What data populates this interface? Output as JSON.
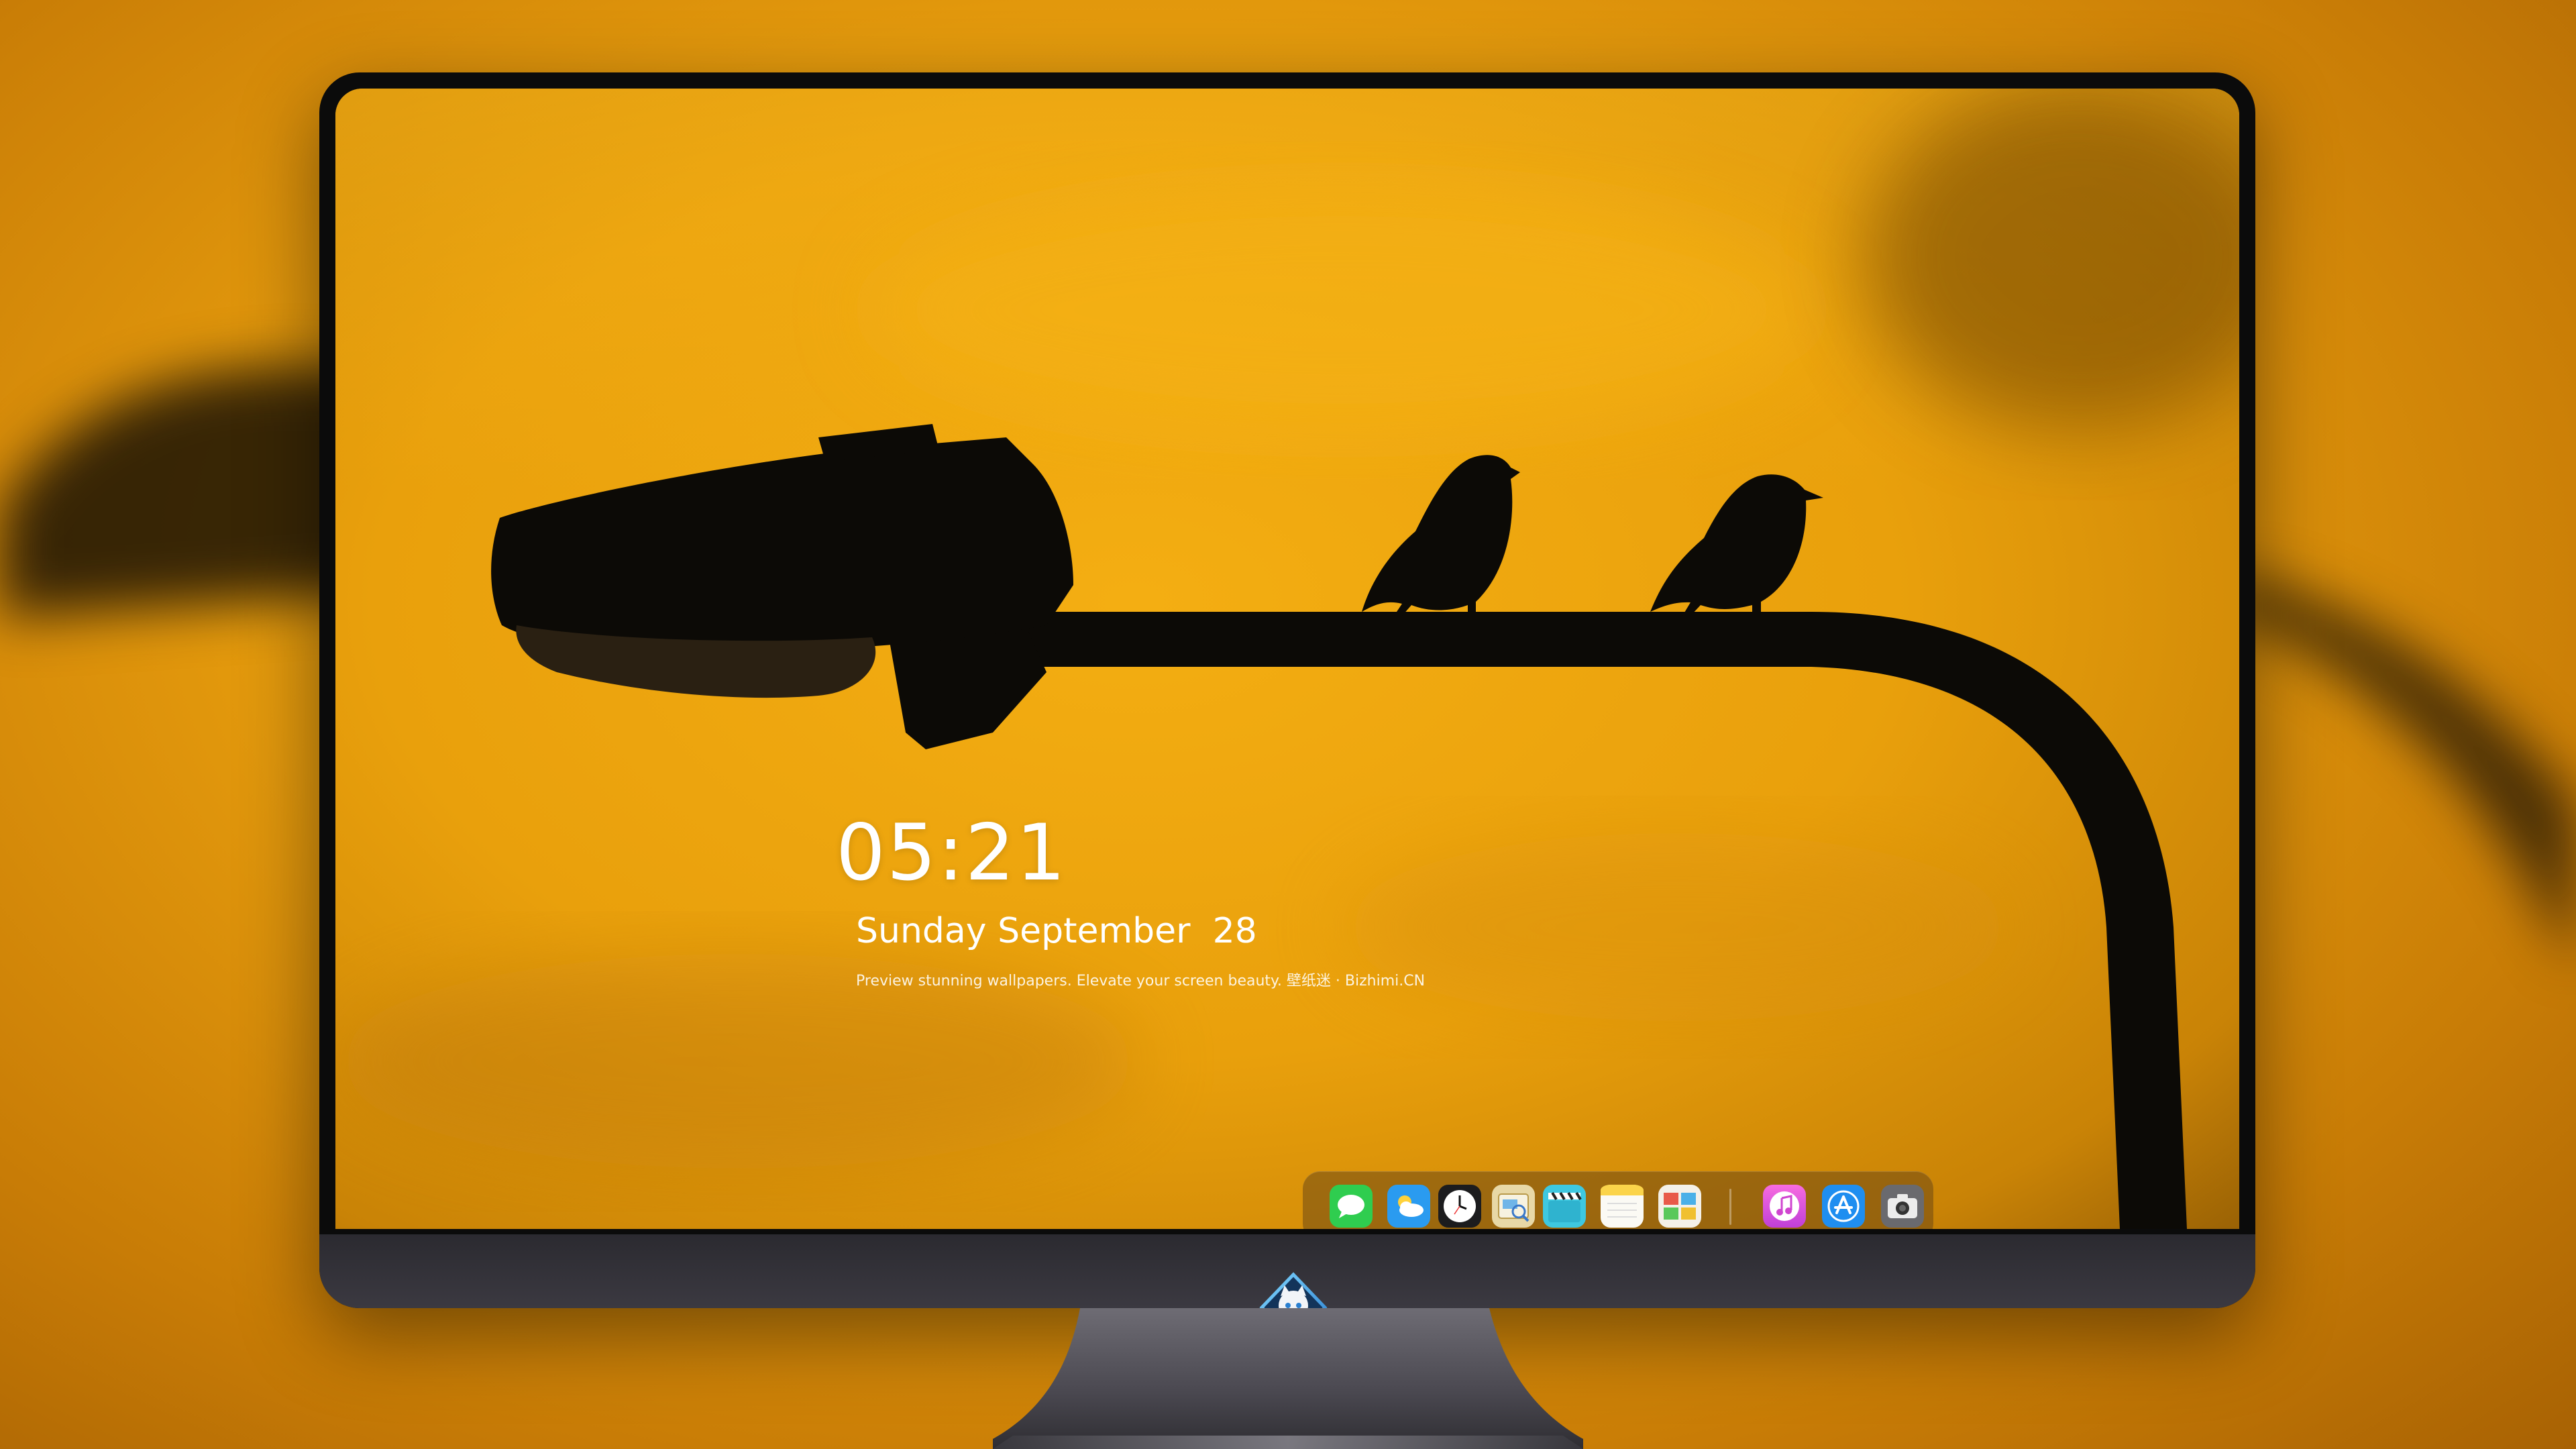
{
  "lockscreen": {
    "time": "05:21",
    "date": "Sunday September  28",
    "caption": "Preview stunning wallpapers. Elevate your screen beauty. 壁纸迷 · Bizhimi.CN"
  },
  "dock": {
    "apps": [
      {
        "icon": "messages-icon",
        "color": "#2fcd4f"
      },
      {
        "icon": "weather-icon",
        "color": "#2a9bf0"
      },
      {
        "icon": "clock-icon",
        "color": "#1c1c1e"
      },
      {
        "icon": "preview-icon",
        "color": "#e8d8a6"
      },
      {
        "icon": "clapperboard-icon",
        "color": "#3ec8e0"
      },
      {
        "icon": "notes-icon",
        "color": "#fbe28a"
      },
      {
        "icon": "photo-booth-icon",
        "color": "#f4f0e8"
      },
      {
        "icon": "music-icon",
        "color": "#e34fd0"
      },
      {
        "icon": "app-store-icon",
        "color": "#1f8ef0"
      },
      {
        "icon": "camera-icon",
        "color": "#6a6a6e"
      }
    ]
  },
  "colors": {
    "sky": "#e8a010",
    "silhouette": "#0c0a06",
    "bezel": "#0b0b0b",
    "chin": "#3a383f"
  }
}
